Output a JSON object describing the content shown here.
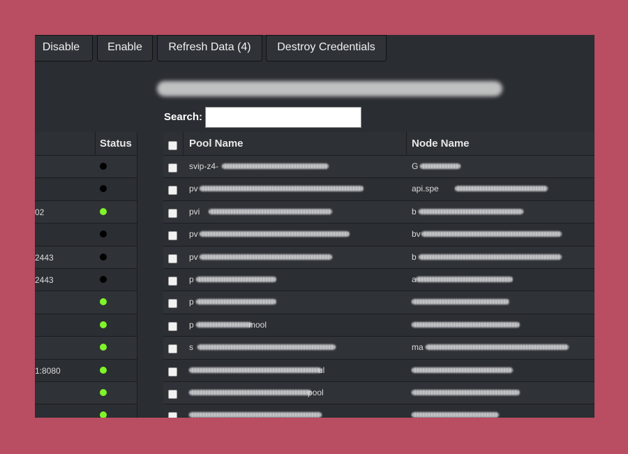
{
  "toolbar": {
    "disable": "Disable",
    "enable": "Enable",
    "refresh": "Refresh Data (4)",
    "destroy": "Destroy Credentials"
  },
  "search": {
    "label": "Search:",
    "value": ""
  },
  "left_table": {
    "status_header": "Status",
    "rows": [
      {
        "text": "",
        "status": "black"
      },
      {
        "text": "",
        "status": "black"
      },
      {
        "text": "02",
        "status": "green"
      },
      {
        "text": "",
        "status": "black"
      },
      {
        "text": "2443",
        "status": "black"
      },
      {
        "text": "2443",
        "status": "black"
      },
      {
        "text": "",
        "status": "green"
      },
      {
        "text": "",
        "status": "green"
      },
      {
        "text": "",
        "status": "green"
      },
      {
        "text": "1:8080",
        "status": "green"
      },
      {
        "text": "",
        "status": "green"
      },
      {
        "text": "",
        "status": "green"
      }
    ]
  },
  "pools": {
    "col_pool": "Pool Name",
    "col_node": "Node Name",
    "rows": [
      {
        "pool": "svip-z4-",
        "pool_suffix": "",
        "node": "G"
      },
      {
        "pool": "pv",
        "pool_suffix": "",
        "node": "api.spe"
      },
      {
        "pool": "pvi",
        "pool_suffix": "",
        "node": "b"
      },
      {
        "pool": "pv",
        "pool_suffix": "",
        "node": "bv"
      },
      {
        "pool": "pv",
        "pool_suffix": "",
        "node": "b"
      },
      {
        "pool": "p",
        "pool_suffix": "",
        "node": "a"
      },
      {
        "pool": "p",
        "pool_suffix": "",
        "node": ""
      },
      {
        "pool": "p",
        "pool_suffix": "mool",
        "node": ""
      },
      {
        "pool": "s",
        "pool_suffix": "",
        "node": "ma"
      },
      {
        "pool": "",
        "pool_suffix": "ul",
        "node": ""
      },
      {
        "pool": "",
        "pool_suffix": "pool",
        "node": ""
      },
      {
        "pool": "",
        "pool_suffix": "",
        "node": ""
      }
    ]
  },
  "colors": {
    "status_green": "#7ff528",
    "status_black": "#000000",
    "app_bg": "#2a2d32",
    "frame_bg": "#b94d62"
  }
}
